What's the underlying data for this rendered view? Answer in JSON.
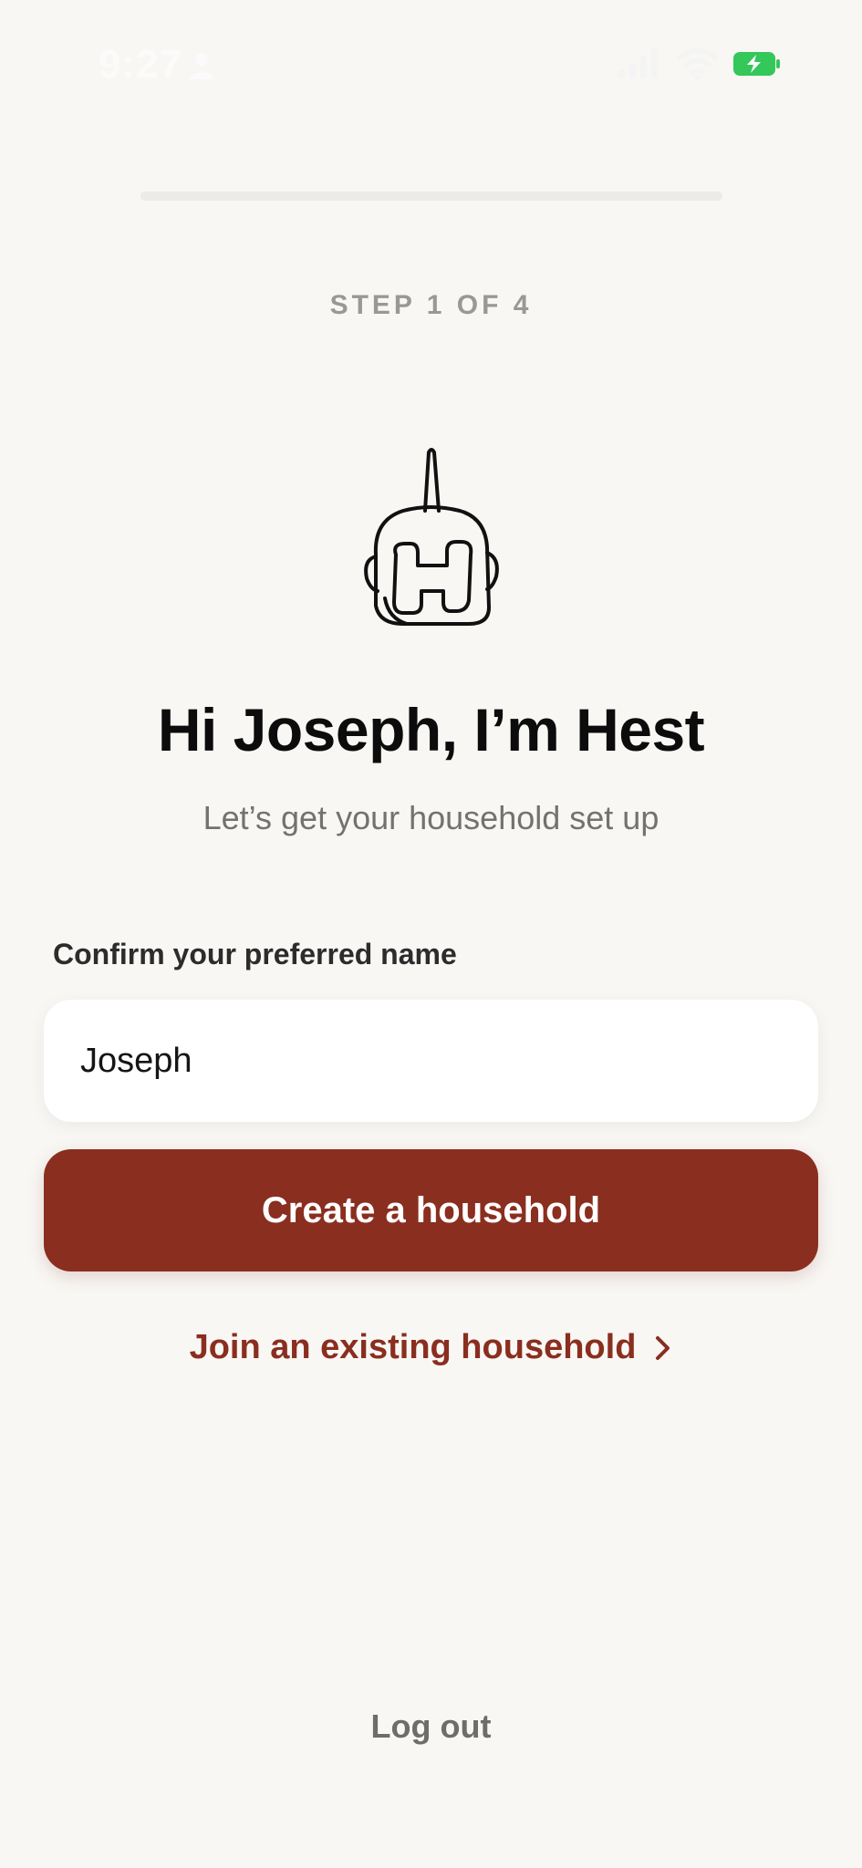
{
  "status_bar": {
    "time": "9:27",
    "icons": [
      "person-icon",
      "signal-icon",
      "wifi-icon",
      "battery-charging-icon"
    ],
    "battery_color": "#34c759"
  },
  "progress": {
    "step_label": "STEP 1 OF 4",
    "fraction": 0.25
  },
  "header": {
    "title": "Hi Joseph, I’m Hest",
    "subtitle": "Let’s get your household set up"
  },
  "form": {
    "name_label": "Confirm your preferred name",
    "name_value": "Joseph"
  },
  "actions": {
    "create_label": "Create a household",
    "join_label": "Join an existing household",
    "logout_label": "Log out"
  },
  "colors": {
    "accent": "#8a2e1f",
    "background": "#f8f7f4"
  }
}
